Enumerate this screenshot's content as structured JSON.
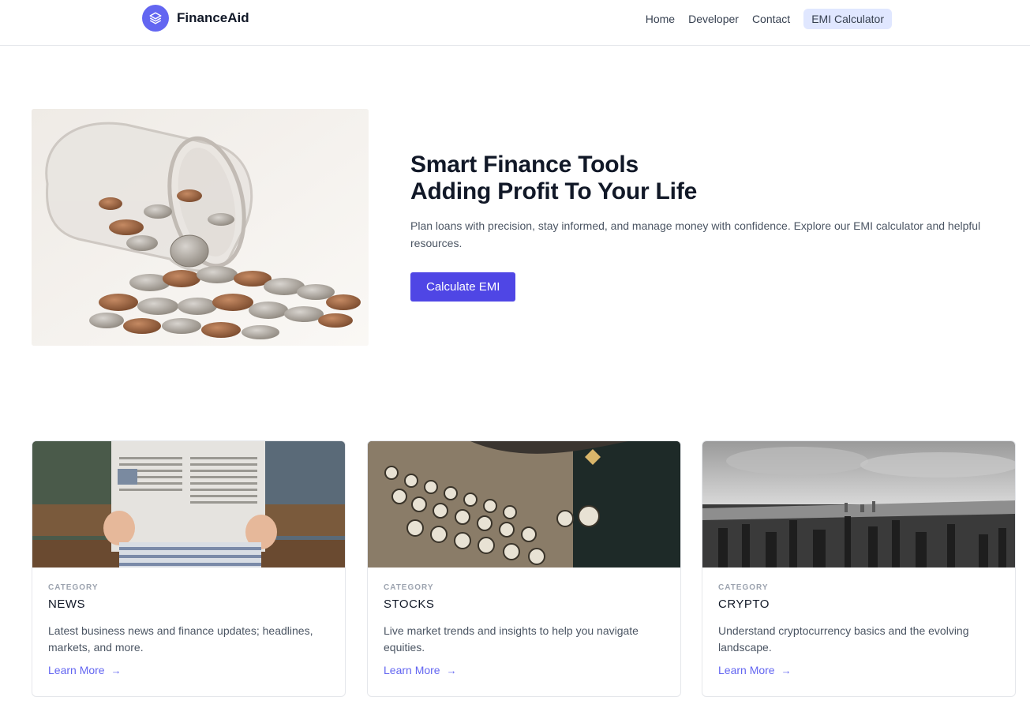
{
  "header": {
    "brand": "FinanceAid",
    "nav": [
      {
        "label": "Home",
        "active": false
      },
      {
        "label": "Developer",
        "active": false
      },
      {
        "label": "Contact",
        "active": false
      },
      {
        "label": "EMI Calculator",
        "active": true
      }
    ]
  },
  "hero": {
    "title_line1": "Smart Finance Tools",
    "title_line2": "Adding Profit To Your Life",
    "description": "Plan loans with precision, stay informed, and manage money with confidence. Explore our EMI calculator and helpful resources.",
    "cta": "Calculate EMI",
    "image": "coins-spilling-from-jar"
  },
  "cards": [
    {
      "category": "CATEGORY",
      "title": "NEWS",
      "description": "Latest business news and finance updates; headlines, markets, and more.",
      "link": "Learn More",
      "image": "person-reading-newspaper"
    },
    {
      "category": "CATEGORY",
      "title": "STOCKS",
      "description": "Live market trends and insights to help you navigate equities.",
      "link": "Learn More",
      "image": "vintage-typewriter-keys"
    },
    {
      "category": "CATEGORY",
      "title": "CRYPTO",
      "description": "Understand cryptocurrency basics and the evolving landscape.",
      "link": "Learn More",
      "image": "city-skyline-black-white"
    }
  ],
  "colors": {
    "accent": "#4f46e5",
    "logo": "#6366f1",
    "active_nav_bg": "#e0e7ff",
    "link": "#6366f1"
  }
}
